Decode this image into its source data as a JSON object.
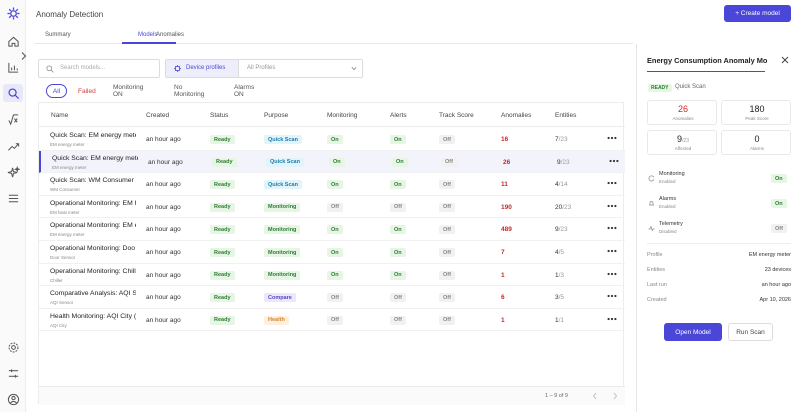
{
  "app": {
    "title": "Anomaly Detection",
    "create_button": "+ Create model"
  },
  "tabs": [
    {
      "label": "Summary"
    },
    {
      "label": "Models",
      "active": true
    },
    {
      "label": "Anomalies"
    }
  ],
  "search": {
    "placeholder": "Search models..."
  },
  "filter": {
    "device_profiles_label": "Device profiles",
    "value": "All Profiles"
  },
  "chips": [
    {
      "label": "All",
      "active": true
    },
    {
      "label": "Failed"
    },
    {
      "label": "Monitoring ON"
    },
    {
      "label": "No Monitoring"
    },
    {
      "label": "Alarms ON"
    }
  ],
  "table": {
    "headers": [
      "Name",
      "Created",
      "Status",
      "Purpose",
      "Monitoring",
      "Alerts",
      "Track Score",
      "Anomalies",
      "Entities"
    ],
    "rows": [
      {
        "name": "Quick Scan: EM energy meter",
        "sub": "EM energy meter",
        "created": "an hour ago",
        "status": "Ready",
        "purpose": "Quick Scan",
        "monitoring": "On",
        "alerts": "On",
        "track": "Off",
        "anomalies": "16",
        "entities": "7",
        "entities_total": "/23"
      },
      {
        "name": "Quick Scan: EM energy meter",
        "sub": "EM energy meter",
        "created": "an hour ago",
        "status": "Ready",
        "purpose": "Quick Scan",
        "monitoring": "On",
        "alerts": "On",
        "track": "Off",
        "anomalies": "26",
        "entities": "9",
        "entities_total": "/23",
        "selected": true
      },
      {
        "name": "Quick Scan: WM Consumer (c",
        "sub": "WM Consumer",
        "created": "an hour ago",
        "status": "Ready",
        "purpose": "Quick Scan",
        "monitoring": "On",
        "alerts": "On",
        "track": "Off",
        "anomalies": "11",
        "entities": "4",
        "entities_total": "/14"
      },
      {
        "name": "Operational Monitoring: EM h",
        "sub": "EM heat meter",
        "created": "an hour ago",
        "status": "Ready",
        "purpose": "Monitoring",
        "monitoring": "Off",
        "alerts": "Off",
        "track": "Off",
        "anomalies": "190",
        "entities": "20",
        "entities_total": "/23"
      },
      {
        "name": "Operational Monitoring: EM e",
        "sub": "EM energy meter",
        "created": "an hour ago",
        "status": "Ready",
        "purpose": "Monitoring",
        "monitoring": "On",
        "alerts": "On",
        "track": "Off",
        "anomalies": "489",
        "entities": "9",
        "entities_total": "/23"
      },
      {
        "name": "Operational Monitoring: Doo",
        "sub": "Door Sensor",
        "created": "an hour ago",
        "status": "Ready",
        "purpose": "Monitoring",
        "monitoring": "On",
        "alerts": "On",
        "track": "Off",
        "anomalies": "7",
        "entities": "4",
        "entities_total": "/5"
      },
      {
        "name": "Operational Monitoring: Chill",
        "sub": "Chiller",
        "created": "an hour ago",
        "status": "Ready",
        "purpose": "Monitoring",
        "monitoring": "On",
        "alerts": "On",
        "track": "Off",
        "anomalies": "1",
        "entities": "1",
        "entities_total": "/3"
      },
      {
        "name": "Comparative Analysis: AQI Se",
        "sub": "AQI Sensor",
        "created": "an hour ago",
        "status": "Ready",
        "purpose": "Compare",
        "monitoring": "Off",
        "alerts": "Off",
        "track": "Off",
        "anomalies": "6",
        "entities": "3",
        "entities_total": "/5"
      },
      {
        "name": "Health Monitoring: AQI City (",
        "sub": "AQI City",
        "created": "an hour ago",
        "status": "Ready",
        "purpose": "Health",
        "monitoring": "Off",
        "alerts": "Off",
        "track": "Off",
        "anomalies": "1",
        "entities": "1",
        "entities_total": "/1"
      }
    ],
    "pagination": "1 – 9 of 9"
  },
  "panel": {
    "title": "Energy Consumption Anomaly Model",
    "status": "READY",
    "type": "Quick Scan",
    "stats": [
      {
        "value": "26",
        "total": "",
        "label": "Anomalies",
        "color": "#c62828"
      },
      {
        "value": "180",
        "total": "",
        "label": "Peak Score",
        "color": "#222222"
      },
      {
        "value": "9",
        "total": "/23",
        "label": "Affected",
        "color": "#222222"
      },
      {
        "value": "0",
        "label": "Alarms",
        "color": "#222222"
      }
    ],
    "toggles": [
      {
        "label": "Monitoring",
        "sub": "Enabled",
        "value": "On",
        "on": true
      },
      {
        "label": "Alarms",
        "sub": "Enabled",
        "value": "On",
        "on": true
      },
      {
        "label": "Telemetry",
        "sub": "Disabled",
        "value": "Off",
        "on": false
      }
    ],
    "meta": [
      {
        "key": "Profile",
        "value": "EM energy meter"
      },
      {
        "key": "Entities",
        "value": "23 devices"
      },
      {
        "key": "Last run",
        "value": "an hour ago"
      },
      {
        "key": "Created",
        "value": "Apr 10, 2026"
      }
    ],
    "open_button": "Open Model",
    "run_button": "Run Scan"
  },
  "colors": {
    "accent": "#4a47d8",
    "ready_bg": "#e6f5e4",
    "ready_fg": "#2e7d32",
    "anomaly": "#c62828"
  },
  "purpose_styles": {
    "Quick Scan": {
      "bg": "#e1f3fb",
      "fg": "#1a7fa8"
    },
    "Monitoring": {
      "bg": "#e6f5e4",
      "fg": "#2e7d32"
    },
    "Compare": {
      "bg": "#ece8fb",
      "fg": "#5b3fc4"
    },
    "Health": {
      "bg": "#fdf0e0",
      "fg": "#d9822b"
    }
  }
}
